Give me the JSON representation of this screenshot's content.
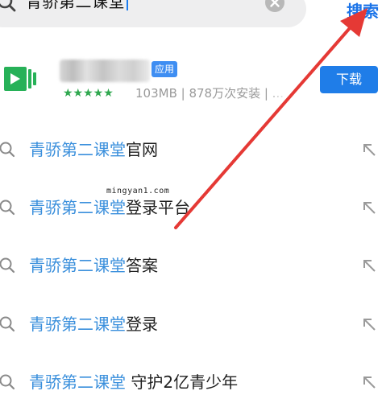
{
  "search": {
    "query": "青骄第二课堂",
    "submit_label": "搜索"
  },
  "app_card": {
    "tag": "应用",
    "stars": "★★★★★",
    "meta": "103MB | 878万次安装 | ...",
    "download_label": "下载",
    "icon_color": "#27b158"
  },
  "suggestions": [
    {
      "query": "青骄第二课堂",
      "rest": "官网"
    },
    {
      "query": "青骄第二课堂",
      "rest": "登录平台"
    },
    {
      "query": "青骄第二课堂",
      "rest": "答案"
    },
    {
      "query": "青骄第二课堂",
      "rest": "登录"
    },
    {
      "query": "青骄第二课堂",
      "rest": " 守护2亿青少年"
    }
  ],
  "watermark": "mingyan1.com",
  "colors": {
    "accent": "#1a73e8",
    "query_highlight": "#3a8fdc",
    "annotation_arrow": "#e53935"
  }
}
